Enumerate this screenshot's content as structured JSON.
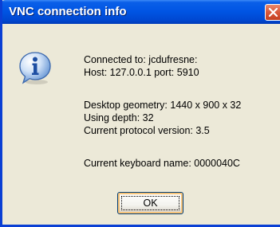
{
  "window": {
    "title": "VNC connection info"
  },
  "icons": {
    "message": "info-icon",
    "close": "close-icon"
  },
  "message": {
    "connected_to": "Connected to: jcdufresne:",
    "host": "Host: 127.0.0.1 port: 5910",
    "desktop_geometry": "Desktop geometry: 1440 x 900 x 32",
    "depth": "Using depth: 32",
    "protocol": "Current protocol version: 3.5",
    "keyboard": "Current keyboard name: 0000040C"
  },
  "buttons": {
    "ok_label": "OK"
  },
  "colors": {
    "titlebar": "#0054e3",
    "close_button": "#d8573a",
    "dialog_background": "#ece9d8"
  }
}
